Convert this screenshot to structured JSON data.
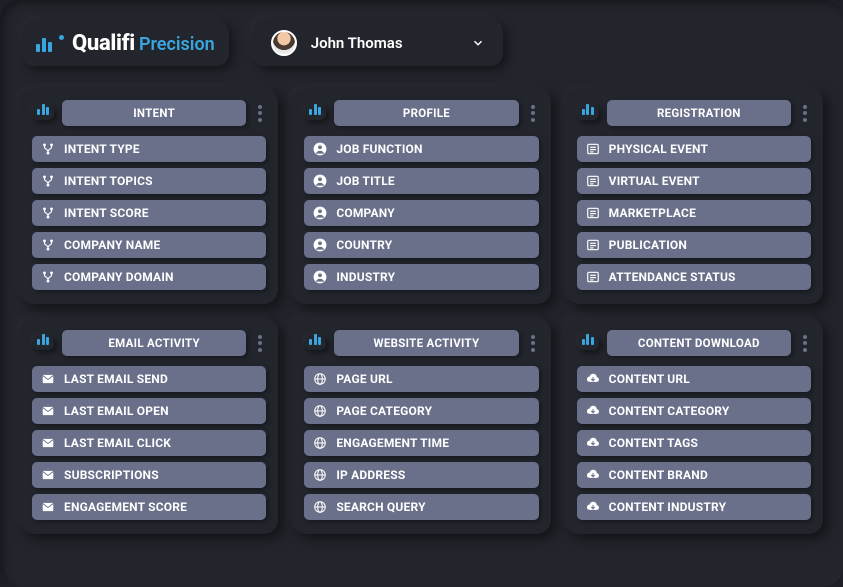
{
  "brand": {
    "name": "Qualifi",
    "suffix": "Precision"
  },
  "user": {
    "name": "John Thomas"
  },
  "cards": [
    {
      "title": "INTENT",
      "icon": "fork",
      "items": [
        "INTENT TYPE",
        "INTENT TOPICS",
        "INTENT SCORE",
        "COMPANY NAME",
        "COMPANY DOMAIN"
      ]
    },
    {
      "title": "PROFILE",
      "icon": "person",
      "items": [
        "JOB FUNCTION",
        "JOB TITLE",
        "COMPANY",
        "COUNTRY",
        "INDUSTRY"
      ]
    },
    {
      "title": "REGISTRATION",
      "icon": "list",
      "items": [
        "PHYSICAL EVENT",
        "VIRTUAL EVENT",
        "MARKETPLACE",
        "PUBLICATION",
        "ATTENDANCE STATUS"
      ]
    },
    {
      "title": "EMAIL ACTIVITY",
      "icon": "mail",
      "items": [
        "LAST EMAIL SEND",
        "LAST EMAIL OPEN",
        "LAST EMAIL CLICK",
        "SUBSCRIPTIONS",
        "ENGAGEMENT SCORE"
      ]
    },
    {
      "title": "WEBSITE ACTIVITY",
      "icon": "globe",
      "items": [
        "PAGE URL",
        "PAGE CATEGORY",
        "ENGAGEMENT TIME",
        "IP ADDRESS",
        "SEARCH QUERY"
      ]
    },
    {
      "title": "CONTENT DOWNLOAD",
      "icon": "download",
      "items": [
        "CONTENT URL",
        "CONTENT CATEGORY",
        "CONTENT TAGS",
        "CONTENT BRAND",
        "CONTENT INDUSTRY"
      ]
    }
  ]
}
